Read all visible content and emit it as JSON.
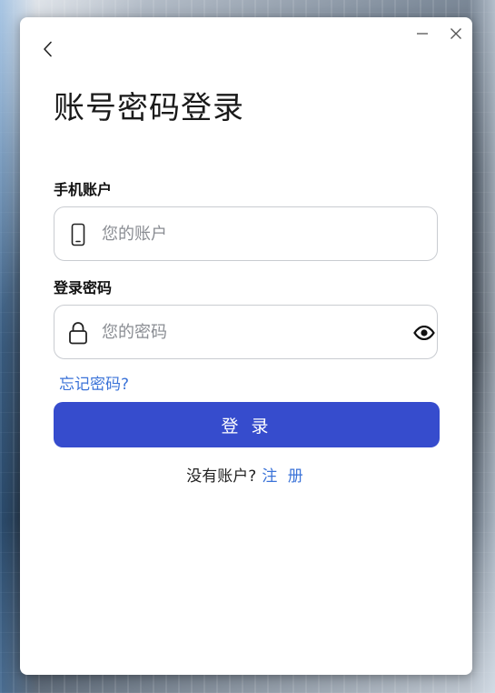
{
  "window": {
    "minimize_icon": "minimize-icon",
    "close_icon": "close-icon"
  },
  "header": {
    "back_icon": "chevron-left-icon",
    "title": "账号密码登录"
  },
  "form": {
    "account": {
      "label": "手机账户",
      "placeholder": "您的账户",
      "value": "",
      "icon": "phone-icon"
    },
    "password": {
      "label": "登录密码",
      "placeholder": "您的密码",
      "value": "",
      "icon": "lock-icon",
      "toggle_icon": "eye-icon"
    },
    "forgot_label": "忘记密码?",
    "login_label": "登 录"
  },
  "footer": {
    "prompt": "没有账户?",
    "register_label": "注 册"
  },
  "colors": {
    "primary_button": "#364ccd",
    "link": "#3b73d8",
    "input_border": "#c9ccd1"
  }
}
